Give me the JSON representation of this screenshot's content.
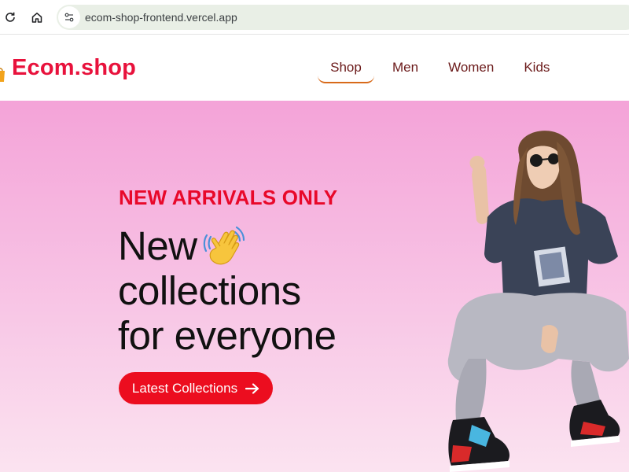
{
  "browser": {
    "url": "ecom-shop-frontend.vercel.app",
    "icons": {
      "reload": "reload-icon",
      "home": "home-icon",
      "site_info": "site-info-icon"
    }
  },
  "header": {
    "logo_text": "Ecom.shop",
    "logo_icon": "shopping-bag-icon",
    "nav": [
      {
        "label": "Shop",
        "active": true
      },
      {
        "label": "Men",
        "active": false
      },
      {
        "label": "Women",
        "active": false
      },
      {
        "label": "Kids",
        "active": false
      }
    ]
  },
  "hero": {
    "eyebrow": "NEW ARRIVALS ONLY",
    "headline_line1": "New",
    "headline_line2": "collections",
    "headline_line3": "for everyone",
    "wave_icon": "hand-wave-icon",
    "cta_label": "Latest Collections",
    "cta_icon": "arrow-right-icon"
  },
  "colors": {
    "brand": "#e8123c",
    "cta": "#ec0d1f",
    "nav_text": "#6b1a1a",
    "nav_active_underline": "#d86a1a",
    "hero_gradient_top": "#f4a3d8",
    "hero_gradient_bottom": "#fbe3f0"
  }
}
